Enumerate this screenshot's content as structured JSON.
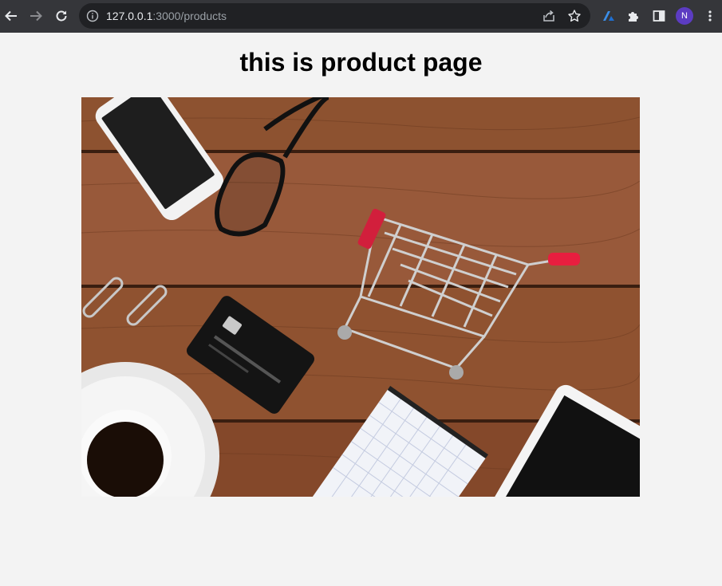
{
  "browser": {
    "url_host": "127.0.0.1",
    "url_path": ":3000/products",
    "profile_initial": "N"
  },
  "page": {
    "heading": "this is product page",
    "image_icon": "product-photo-shopping-cart-desk"
  }
}
